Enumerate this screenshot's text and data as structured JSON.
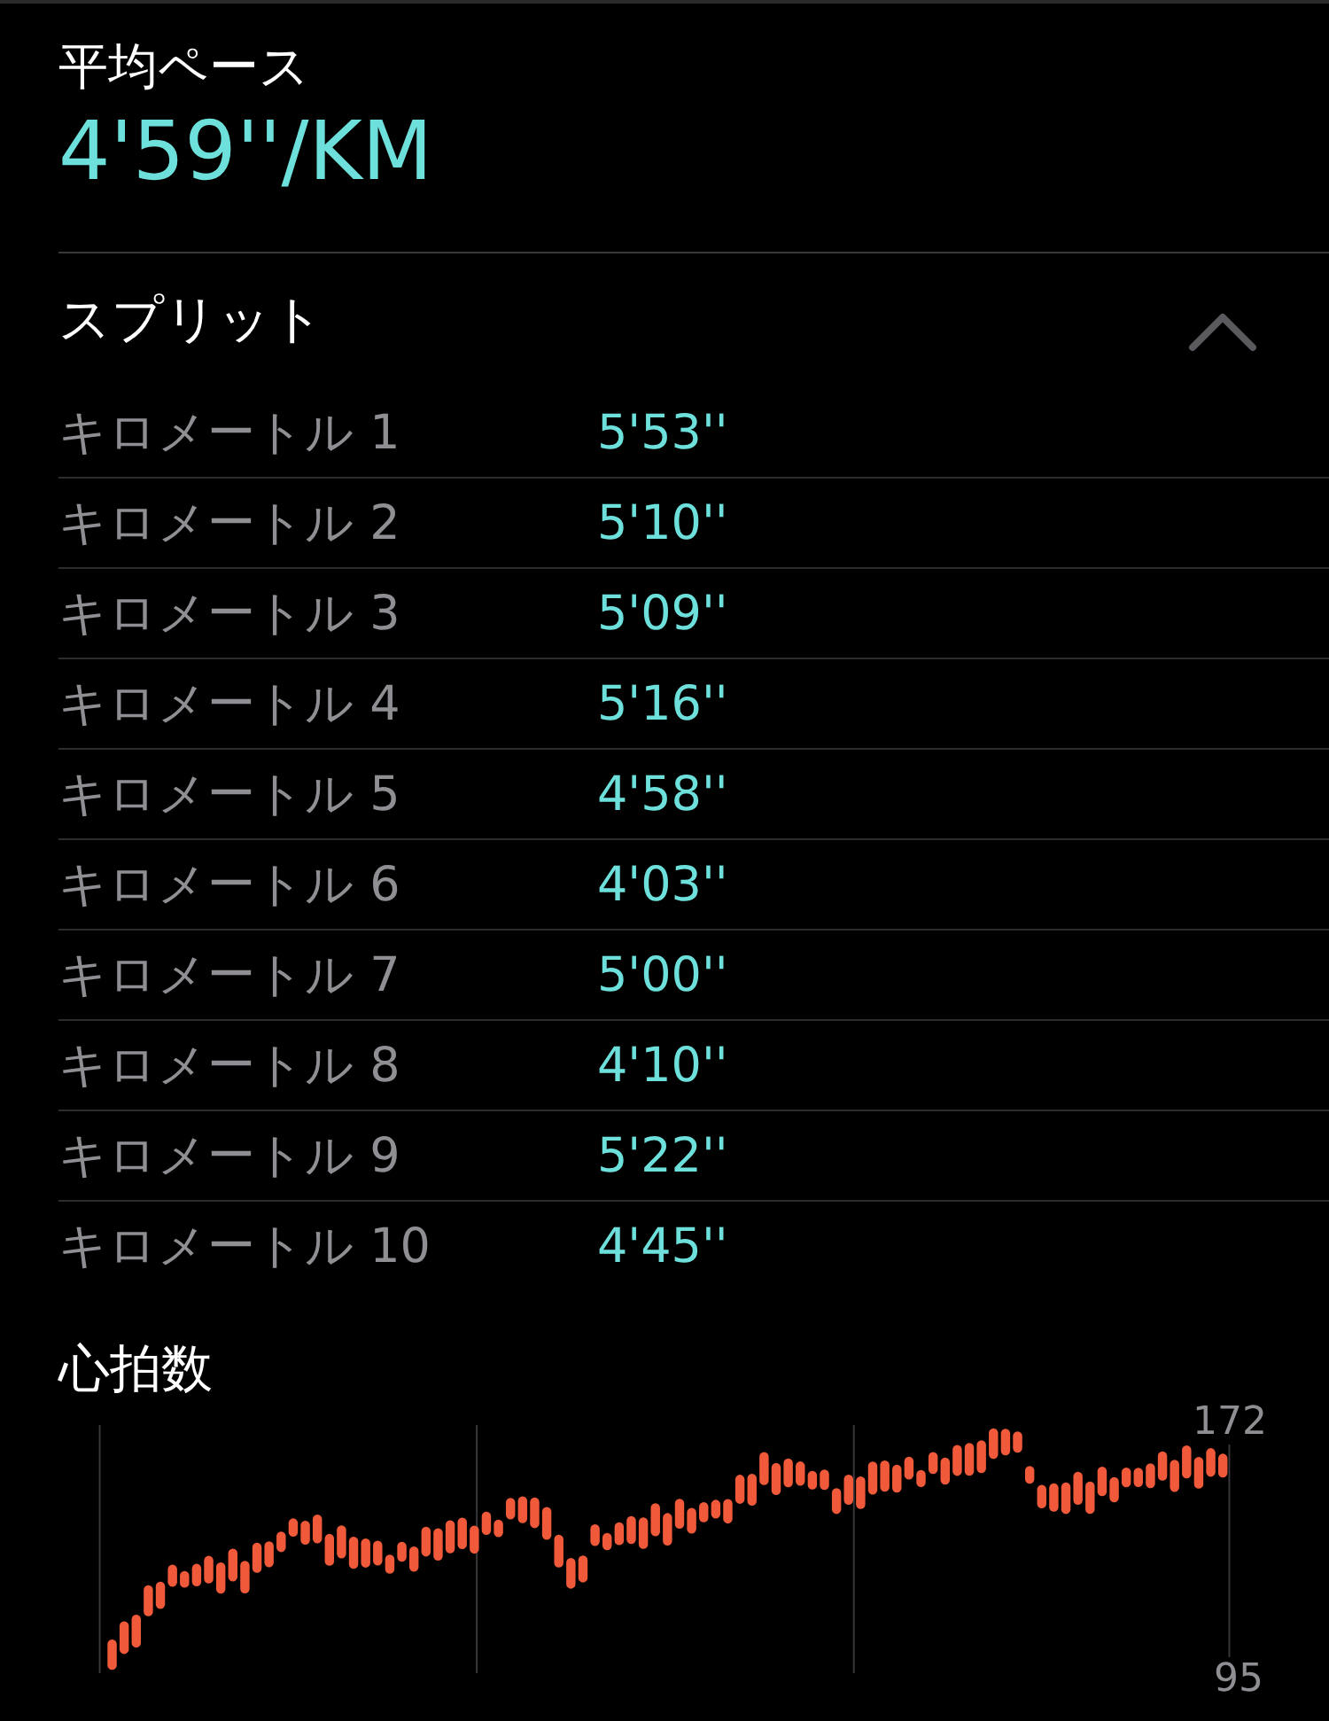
{
  "average_pace": {
    "label": "平均ペース",
    "value": "4'59''/KM"
  },
  "splits": {
    "title": "スプリット",
    "expanded": true,
    "rows": [
      {
        "label": "キロメートル 1",
        "pace": "5'53''"
      },
      {
        "label": "キロメートル 2",
        "pace": "5'10''"
      },
      {
        "label": "キロメートル 3",
        "pace": "5'09''"
      },
      {
        "label": "キロメートル 4",
        "pace": "5'16''"
      },
      {
        "label": "キロメートル 5",
        "pace": "4'58''"
      },
      {
        "label": "キロメートル 6",
        "pace": "4'03''"
      },
      {
        "label": "キロメートル 7",
        "pace": "5'00''"
      },
      {
        "label": "キロメートル 8",
        "pace": "4'10''"
      },
      {
        "label": "キロメートル 9",
        "pace": "5'22''"
      },
      {
        "label": "キロメートル 10",
        "pace": "4'45''"
      }
    ]
  },
  "heart_rate": {
    "title": "心拍数",
    "max_label": "172",
    "min_label": "95"
  }
}
